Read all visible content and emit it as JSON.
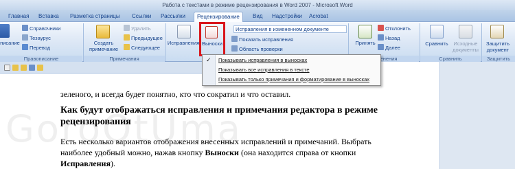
{
  "window": {
    "title": "Работа с текстами в режиме рецензирования в Word 2007 - Microsoft Word"
  },
  "tabs": [
    "Главная",
    "Вставка",
    "Разметка страницы",
    "Ссылки",
    "Рассылки",
    "Рецензирование",
    "Вид",
    "Надстройки",
    "Acrobat"
  ],
  "active_tab": "Рецензирование",
  "ribbon": {
    "proofing": {
      "label": "Правописание",
      "spelling": "описание",
      "reference": "Справочники",
      "thesaurus": "Тезаурус",
      "translate": "Перевод"
    },
    "comments": {
      "label": "Примечания",
      "new_comment": "Создать примечание",
      "delete": "Удалить",
      "previous": "Предыдущее",
      "next": "Следующее"
    },
    "tracking": {
      "label": "Запись исправлений",
      "track_changes": "Исправления",
      "balloons": "Выноски",
      "display_for_review": "Исправления в измененном документе",
      "show_markup": "Показать исправления",
      "reviewing_pane": "Область проверки"
    },
    "changes": {
      "label": "Изменения",
      "accept": "Принять",
      "reject": "Отклонить",
      "previous": "Назад",
      "next": "Далее"
    },
    "compare": {
      "label": "Сравнить",
      "compare": "Сравнить",
      "source_docs": "Исходные документы"
    },
    "protect": {
      "label": "Защитить",
      "protect_doc": "Защитить документ"
    }
  },
  "balloons_menu": {
    "items": [
      "Показывать исправления в выносках",
      "Показывать все исправления в тексте",
      "Показывать только примечания и форматирование в выносках"
    ],
    "checked_index": 0
  },
  "document": {
    "line1": "зеленого, и всегда будет понятно, кто что сократил и что оставил.",
    "heading": "Как будут отображаться исправления и примечания редактора в режиме рецензирования",
    "para_line1": "Есть несколько вариантов отображения внесенных исправлений и примечаний. Выбрать",
    "para_line2_part1": "наиболее удобный можно, нажав кнопку ",
    "para_line2_bold": "Выноски",
    "para_line2_part2": " (она находится справа от кнопки",
    "para_line3_bold": "Исправления",
    "para_line3_end": ")."
  },
  "watermark": "GoroOtUma",
  "colors": {
    "ribbon_text": "#15428b",
    "highlight": "#d9161c"
  }
}
